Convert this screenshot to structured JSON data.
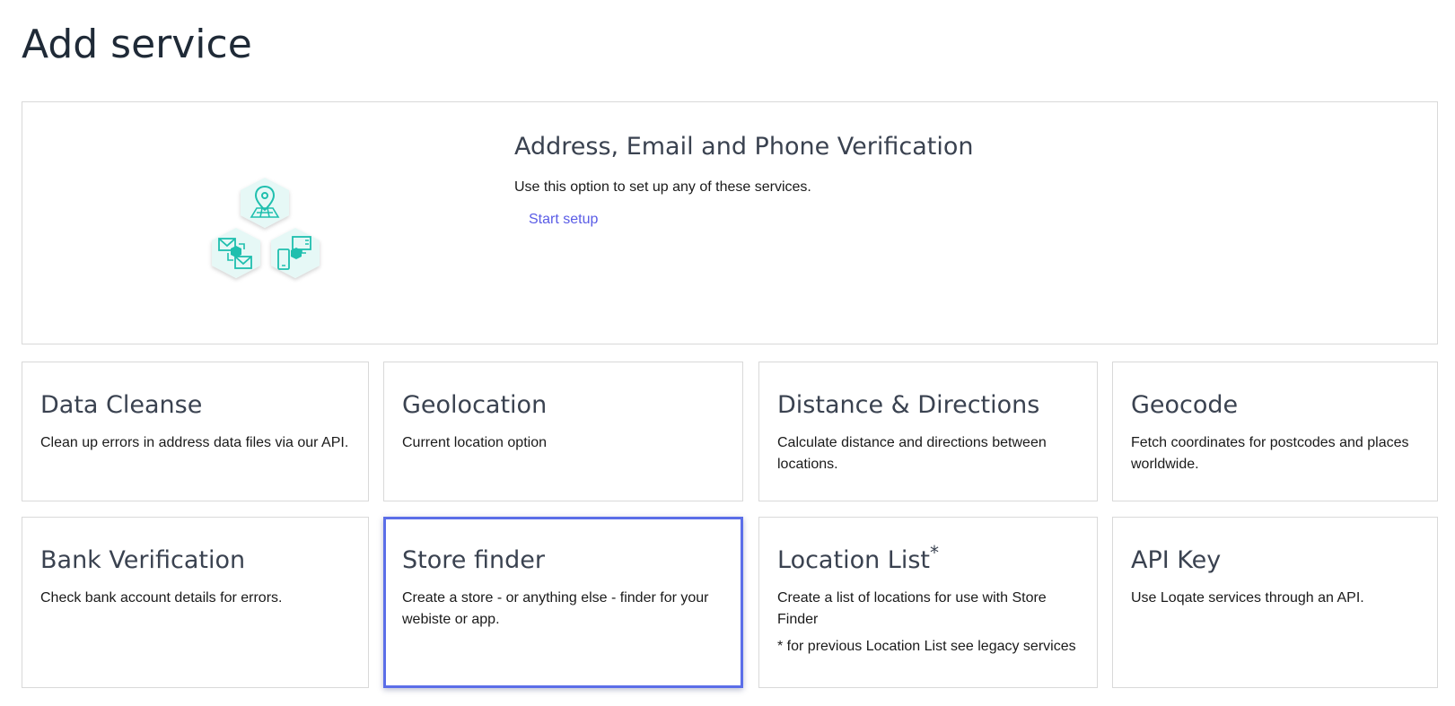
{
  "page": {
    "title": "Add service"
  },
  "hero": {
    "title": "Address, Email and Phone Verification",
    "description": "Use this option to set up any of these services.",
    "link_label": "Start setup",
    "illustration_icons": [
      "map-pin-icon",
      "email-icon",
      "phone-icon"
    ]
  },
  "cards": [
    {
      "title": "Data Cleanse",
      "description": "Clean up errors in address data files via our API."
    },
    {
      "title": "Geolocation",
      "description": "Current location option"
    },
    {
      "title": "Distance & Directions",
      "description": "Calculate distance and directions between locations."
    },
    {
      "title": "Geocode",
      "description": "Fetch coordinates for postcodes and places worldwide."
    },
    {
      "title": "Bank Verification",
      "description": "Check bank account details for errors."
    },
    {
      "title": "Store finder",
      "description": "Create a store - or anything else - finder for your webiste or app.",
      "selected": true
    },
    {
      "title": "Location List",
      "title_superscript": "*",
      "description": "Create a list of locations for use with Store Finder",
      "note": "* for previous Location List see legacy services"
    },
    {
      "title": "API Key",
      "description": "Use Loqate services through an API."
    }
  ],
  "colors": {
    "accent": "#5a5ce6",
    "selected_border": "#5b6ee8",
    "icon_teal": "#1fbfae",
    "hex_fill": "#e6f8f6"
  }
}
